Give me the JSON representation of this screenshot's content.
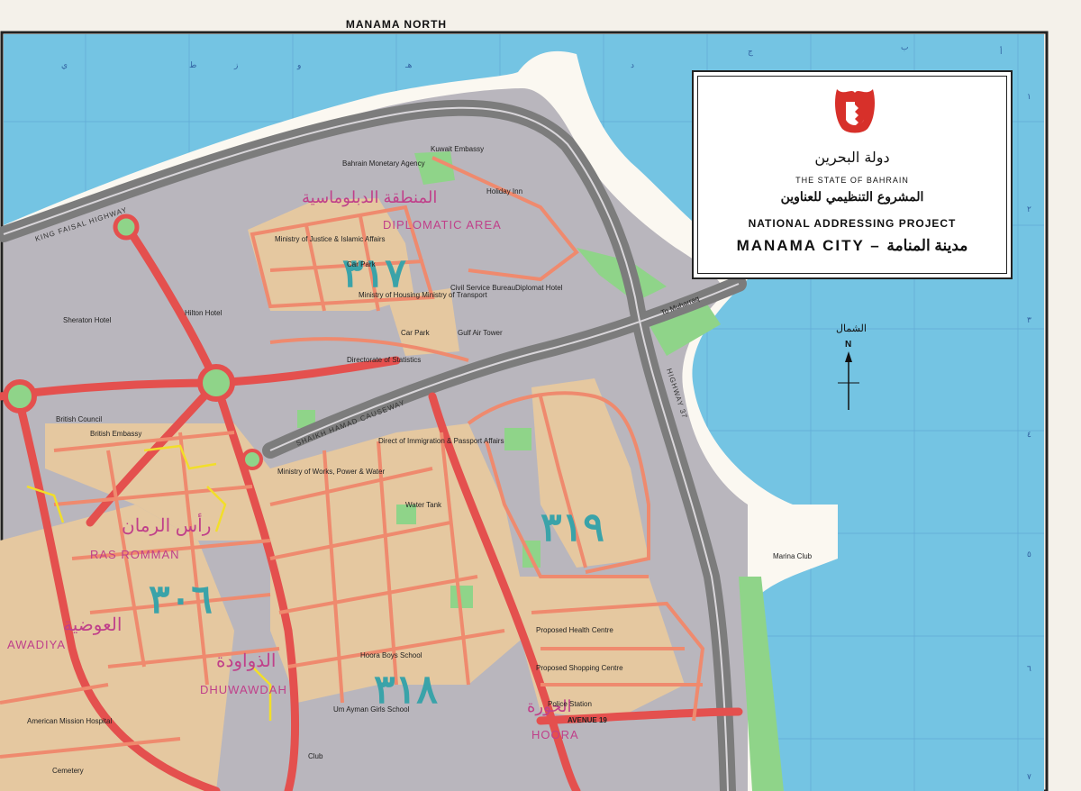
{
  "map": {
    "top_label": "MANAMA NORTH",
    "title_box": {
      "arabic_state": "دولة البحرين",
      "state": "THE STATE OF BAHRAIN",
      "arabic_project": "المشروع التنظيمي للعناوين",
      "project": "NATIONAL ADDRESSING PROJECT",
      "city": "MANAMA CITY – مدينة المنامة"
    },
    "north": {
      "arabic": "الشمال",
      "letter": "N"
    },
    "roads": {
      "king_faisal": "KING FAISAL HIGHWAY",
      "causeway": "SHAIKH HAMAD CAUSEWAY",
      "highway37": "HIGHWAY 37",
      "muharraq": "To Muharraq",
      "avenue19": "AVENUE 19"
    },
    "areas": {
      "diplomatic": "DIPLOMATIC AREA",
      "ras_romman": "RAS ROMMAN",
      "awadiya": "AWADIYA",
      "dhuwawdah": "DHUWAWDAH",
      "hoora": "HOORA"
    },
    "block_numbers": {
      "b317": "٣١٧",
      "b319": "٣١٩",
      "b306": "٣٠٦",
      "b318": "٣١٨"
    },
    "landmarks": {
      "kuwait_embassy": "Kuwait Embassy",
      "bahrain_monetary": "Bahrain Monetary Agency",
      "holiday_inn": "Holiday Inn",
      "justice": "Ministry of Justice & Islamic Affairs",
      "car_park": "Car Park",
      "civil_service": "Civil Service Bureau",
      "diplomat_hotel": "Diplomat Hotel",
      "housing": "Ministry of Housing Ministry of Transport",
      "car_park2": "Car Park",
      "gulf_air": "Gulf Air Tower",
      "statistics": "Directorate of Statistics",
      "sheraton": "Sheraton Hotel",
      "hilton": "Hilton Hotel",
      "british_council": "British Council",
      "british_embassy": "British Embassy",
      "immigration": "Direct of Immigration & Passport Affairs",
      "works": "Ministry of Works, Power & Water",
      "water_tank": "Water Tank",
      "health_centre": "Proposed Health Centre",
      "shopping_centre": "Proposed Shopping Centre",
      "police": "Police Station",
      "hoora_boys": "Hoora Boys School",
      "um_ayman": "Um Ayman Girls School",
      "club": "Club",
      "cemetery": "Cemetery",
      "mission_hospital": "American Mission Hospital",
      "marina_club": "Marina Club"
    },
    "grid_letters_top": [
      "ي",
      "ط",
      "ز",
      "و",
      "هـ",
      "د",
      "ج",
      "ب",
      "أ"
    ],
    "grid_numbers_right": [
      "١",
      "٢",
      "٣",
      "٤",
      "٥",
      "٦",
      "٧"
    ],
    "colors": {
      "sea": "#74c4e3",
      "land_gray": "#b9b6bd",
      "blocks_tan": "#e5c8a0",
      "main_road": "#e4504e",
      "secondary_road": "#ef8a6e",
      "highway": "#7c7c7c",
      "green": "#8fd489",
      "magenta": "#c0408a",
      "teal": "#3aa3a9"
    }
  }
}
